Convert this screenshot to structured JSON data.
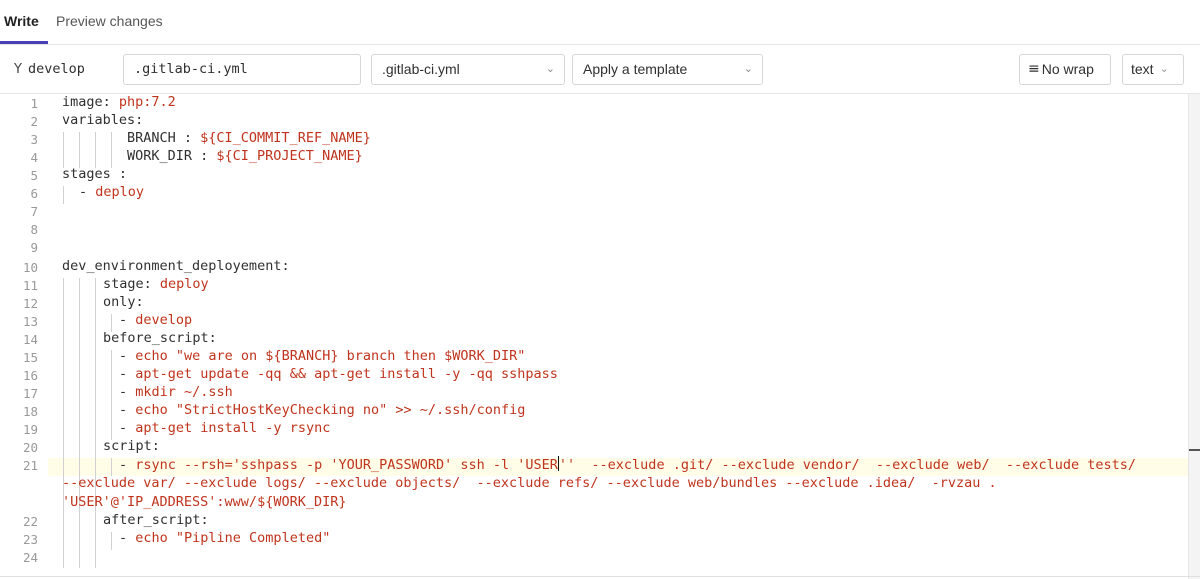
{
  "tabs": {
    "write": "Write",
    "preview": "Preview changes"
  },
  "toolbar": {
    "branch_icon": "fork-branch-icon",
    "branch": "develop",
    "filename": ".gitlab-ci.yml",
    "template_type": ".gitlab-ci.yml",
    "template_placeholder": "Apply a template",
    "nowrap_label": "No wrap",
    "nowrap_icon": "wrap-lines-icon",
    "mode_label": "text"
  },
  "colors": {
    "accent": "#4a3fb5",
    "string": "#c0341d",
    "highlight": "#fffce8"
  },
  "editor": {
    "line_numbers": [
      "1",
      "2",
      "3",
      "4",
      "5",
      "6",
      "7",
      "8",
      "9",
      "10",
      "11",
      "12",
      "13",
      "14",
      "15",
      "16",
      "17",
      "18",
      "19",
      "20",
      "21",
      "22",
      "23",
      "24"
    ],
    "lines": {
      "l1a": "image: ",
      "l1b": "php:7.2",
      "l2": "variables:",
      "l3a": "BRANCH : ",
      "l3b": "${CI_COMMIT_REF_NAME}",
      "l4a": "WORK_DIR : ",
      "l4b": "${CI_PROJECT_NAME}",
      "l5": "stages :",
      "l6a": "- ",
      "l6b": "deploy",
      "l10": "dev_environment_deployement:",
      "l11a": "stage: ",
      "l11b": "deploy",
      "l12": "only:",
      "l13a": "- ",
      "l13b": "develop",
      "l14": "before_script:",
      "l15a": "- ",
      "l15b": "echo \"we are on ${BRANCH} branch then $WORK_DIR\"",
      "l16a": "- ",
      "l16b": "apt-get update -qq && apt-get install -y -qq sshpass",
      "l17a": "- ",
      "l17b": "mkdir ~/.ssh",
      "l18a": "- ",
      "l18b": "echo \"StrictHostKeyChecking no\" >> ~/.ssh/config",
      "l19a": "- ",
      "l19b": "apt-get install -y rsync",
      "l20": "script:",
      "l21a": "- ",
      "l21b": "rsync --rsh='sshpass -p 'YOUR_PASSWORD' ssh -l 'USER",
      "l21c": "''  --exclude .git/ --exclude vendor/  --exclude web/  --exclude tests/",
      "l21d": "--exclude var/ --exclude logs/ --exclude objects/  --exclude refs/ --exclude web/bundles --exclude .idea/  -rvzau .",
      "l21e": "'USER'@'IP_ADDRESS':www/${WORK_DIR}",
      "l22": "after_script:",
      "l23a": "- ",
      "l23b": "echo \"Pipline Completed\""
    }
  }
}
